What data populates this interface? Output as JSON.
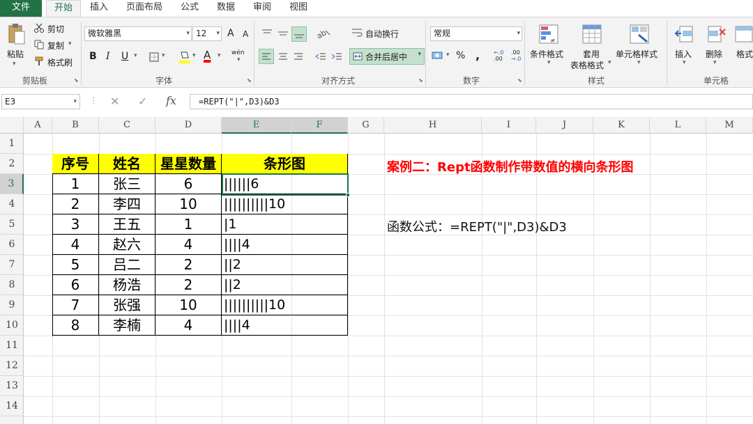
{
  "tabs": [
    "文件",
    "开始",
    "插入",
    "页面布局",
    "公式",
    "数据",
    "审阅",
    "视图"
  ],
  "ribbon": {
    "clipboard": {
      "paste": "粘贴",
      "cut": "剪切",
      "copy": "复制",
      "format_painter": "格式刷",
      "group": "剪贴板"
    },
    "font": {
      "name": "微软雅黑",
      "size": "12",
      "bold": "B",
      "italic": "I",
      "underline": "U",
      "grow": "A",
      "shrink": "A",
      "font_color_glyph": "A",
      "phonetic": "wén",
      "group": "字体"
    },
    "alignment": {
      "wrap": "自动换行",
      "merge": "合并后居中",
      "group": "对齐方式"
    },
    "number": {
      "format": "常规",
      "percent": "%",
      "comma": ",",
      "inc": ".00",
      "dec": ".0",
      "group": "数字"
    },
    "styles": {
      "conditional": "条件格式",
      "table1": "套用",
      "table2": "表格格式",
      "cell_styles": "单元格样式",
      "group": "样式"
    },
    "cells": {
      "insert": "插入",
      "delete": "删除",
      "format": "格式",
      "group": "单元格"
    }
  },
  "namebox": "E3",
  "formula_bar": "=REPT(\"|\",D3)&D3",
  "columns": [
    "A",
    "B",
    "C",
    "D",
    "E",
    "F",
    "G",
    "H",
    "I",
    "J",
    "K",
    "L",
    "M"
  ],
  "rows": [
    "1",
    "2",
    "3",
    "4",
    "5",
    "6",
    "7",
    "8",
    "9",
    "10",
    "11",
    "12",
    "13",
    "14"
  ],
  "table": {
    "headers": [
      "序号",
      "姓名",
      "星星数量",
      "条形图"
    ],
    "rows": [
      [
        "1",
        "张三",
        "6",
        "||||||6"
      ],
      [
        "2",
        "李四",
        "10",
        "||||||||||10"
      ],
      [
        "3",
        "王五",
        "1",
        "|1"
      ],
      [
        "4",
        "赵六",
        "4",
        "||||4"
      ],
      [
        "5",
        "吕二",
        "2",
        "||2"
      ],
      [
        "6",
        "杨浩",
        "2",
        "||2"
      ],
      [
        "7",
        "张强",
        "10",
        "||||||||||10"
      ],
      [
        "8",
        "李楠",
        "4",
        "||||4"
      ]
    ]
  },
  "title": "案例二：Rept函数制作带数值的横向条形图",
  "formula_note": "函数公式：=REPT(\"|\",D3)&D3",
  "colors": {
    "accent": "#217346",
    "header_fill": "#ffff00",
    "title": "#ff0000"
  }
}
